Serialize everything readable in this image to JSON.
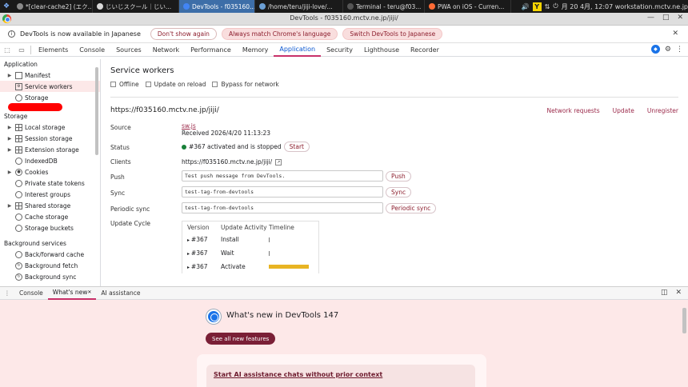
{
  "taskbar": {
    "tasks": [
      {
        "label": "*[clear-cache2] (エク...",
        "color": "#8a8a8a",
        "active": false
      },
      {
        "label": "じいじスクール｜じい...",
        "color": "#d8d8d8",
        "active": false
      },
      {
        "label": "DevTools - f035160...",
        "color": "#4285f4",
        "active": true
      },
      {
        "label": "/home/teru/jiji-love/...",
        "color": "#6b9fd4",
        "active": false
      },
      {
        "label": "Terminal - teru@f03...",
        "color": "#555555",
        "active": false
      },
      {
        "label": "PWA on iOS - Curren...",
        "color": "#ff6b35",
        "active": false
      }
    ],
    "clock": "月 20 4月, 12:07 workstation.mctv.ne.jp",
    "tray_y": "Y"
  },
  "window": {
    "title": "DevTools - f035160.mctv.ne.jp/jiji/"
  },
  "infobar": {
    "message": "DevTools is now available in Japanese",
    "dont_show": "Don't show again",
    "match_lang": "Always match Chrome's language",
    "switch_lang": "Switch DevTools to Japanese"
  },
  "tabs": [
    "Elements",
    "Console",
    "Sources",
    "Network",
    "Performance",
    "Memory",
    "Application",
    "Security",
    "Lighthouse",
    "Recorder"
  ],
  "active_tab": "Application",
  "sidebar": {
    "app_header": "Application",
    "app_items": [
      {
        "label": "Manifest",
        "icon": "file-icon",
        "arrow": true
      },
      {
        "label": "Service workers",
        "icon": "gear-icon",
        "arrow": false,
        "selected": true
      },
      {
        "label": "Storage",
        "icon": "database-icon",
        "arrow": false
      }
    ],
    "storage_header": "Storage",
    "storage_items": [
      {
        "label": "Local storage",
        "icon": "grid-icon",
        "arrow": true
      },
      {
        "label": "Session storage",
        "icon": "grid-icon",
        "arrow": true
      },
      {
        "label": "Extension storage",
        "icon": "grid-icon",
        "arrow": true
      },
      {
        "label": "IndexedDB",
        "icon": "database-icon",
        "arrow": false
      },
      {
        "label": "Cookies",
        "icon": "cookie-icon",
        "arrow": true
      },
      {
        "label": "Private state tokens",
        "icon": "database-icon",
        "arrow": false
      },
      {
        "label": "Interest groups",
        "icon": "database-icon",
        "arrow": false
      },
      {
        "label": "Shared storage",
        "icon": "grid-icon",
        "arrow": true
      },
      {
        "label": "Cache storage",
        "icon": "database-icon",
        "arrow": false
      },
      {
        "label": "Storage buckets",
        "icon": "database-icon",
        "arrow": false
      }
    ],
    "bg_header": "Background services",
    "bg_items": [
      {
        "label": "Back/forward cache",
        "icon": "database-icon"
      },
      {
        "label": "Background fetch",
        "icon": "sync-icon"
      },
      {
        "label": "Background sync",
        "icon": "sync-icon"
      }
    ]
  },
  "sw": {
    "title": "Service workers",
    "checkboxes": [
      "Offline",
      "Update on reload",
      "Bypass for network"
    ],
    "origin": "https://f035160.mctv.ne.jp/jiji/",
    "links": [
      "Network requests",
      "Update",
      "Unregister"
    ],
    "source_label": "Source",
    "source_file": "sw.js",
    "received": "Received 2026/4/20 11:13:23",
    "status_label": "Status",
    "status_text": "#367 activated and is stopped",
    "start_btn": "Start",
    "clients_label": "Clients",
    "clients_value": "https://f035160.mctv.ne.jp/jiji/",
    "push_label": "Push",
    "push_value": "Test push message from DevTools.",
    "push_btn": "Push",
    "sync_label": "Sync",
    "sync_value": "test-tag-from-devtools",
    "sync_btn": "Sync",
    "periodic_label": "Periodic sync",
    "periodic_value": "test-tag-from-devtools",
    "periodic_btn": "Periodic sync",
    "cycle_label": "Update Cycle",
    "cycle_headers": [
      "Version",
      "Update Activity",
      "Timeline"
    ],
    "cycle_rows": [
      {
        "version": "#367",
        "activity": "Install",
        "timeline": "tick"
      },
      {
        "version": "#367",
        "activity": "Wait",
        "timeline": "tick"
      },
      {
        "version": "#367",
        "activity": "Activate",
        "timeline": "bar"
      }
    ]
  },
  "drawer": {
    "tabs": [
      "Console",
      "What's new",
      "AI assistance"
    ],
    "active_tab": "What's new",
    "whatsnew_title": "What's new in DevTools 147",
    "see_all": "See all new features",
    "card_link": "Start AI assistance chats without prior context"
  },
  "colors": {
    "accent": "#c8316a",
    "link": "#9b2a4a",
    "status_green": "#188038",
    "timeline_bar": "#e8b423",
    "drawer_bg": "#fde8e8"
  }
}
